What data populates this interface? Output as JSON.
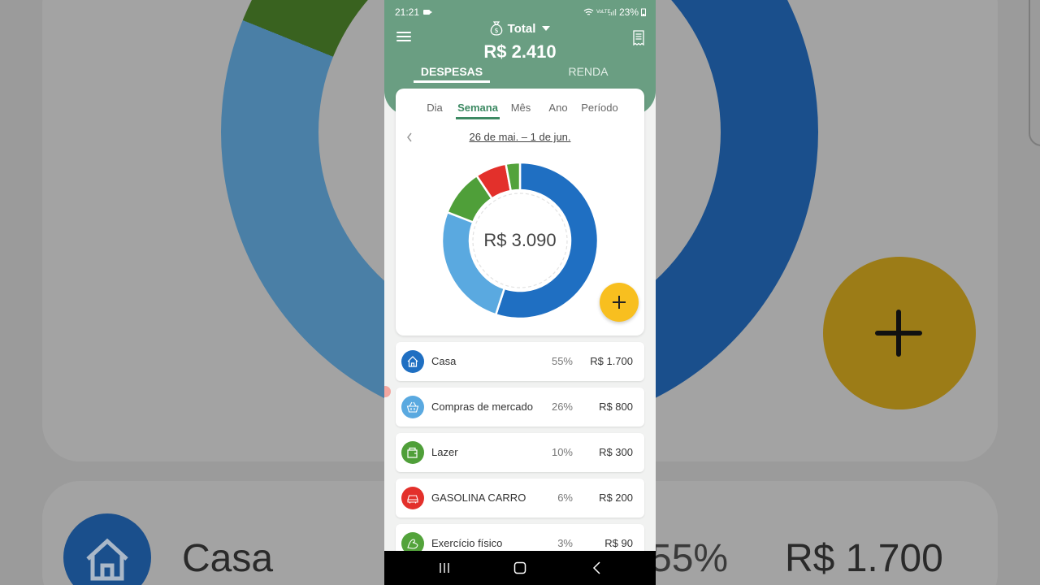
{
  "status_bar": {
    "time": "21:21",
    "network": "VoLTE",
    "battery": "23%"
  },
  "header": {
    "selector_label": "Total",
    "balance": "R$ 2.410",
    "tabs": [
      {
        "label": "DESPESAS",
        "active": true
      },
      {
        "label": "RENDA",
        "active": false
      }
    ]
  },
  "periods": [
    {
      "label": "Dia",
      "active": false
    },
    {
      "label": "Semana",
      "active": true
    },
    {
      "label": "Mês",
      "active": false
    },
    {
      "label": "Ano",
      "active": false
    },
    {
      "label": "Período",
      "active": false
    }
  ],
  "date_range": "26 de mai. – 1 de jun.",
  "donut_total": "R$ 3.090",
  "categories": [
    {
      "name": "Casa",
      "percent": "55%",
      "amount": "R$ 1.700",
      "value": 1700,
      "color": "#1f6fc2",
      "icon": "house-icon"
    },
    {
      "name": "Compras de mercado",
      "percent": "26%",
      "amount": "R$ 800",
      "value": 800,
      "color": "#5aa9e0",
      "icon": "basket-icon"
    },
    {
      "name": "Lazer",
      "percent": "10%",
      "amount": "R$ 300",
      "value": 300,
      "color": "#4f9f39",
      "icon": "wallet-icon"
    },
    {
      "name": "GASOLINA CARRO",
      "percent": "6%",
      "amount": "R$ 200",
      "value": 200,
      "color": "#e3302b",
      "icon": "car-icon"
    },
    {
      "name": "Exercício físico",
      "percent": "3%",
      "amount": "R$ 90",
      "value": 90,
      "color": "#53a33b",
      "icon": "arm-icon"
    }
  ],
  "colors": {
    "header": "#6a9e82",
    "accent": "#3d8a63",
    "fab": "#f8bf1f"
  }
}
